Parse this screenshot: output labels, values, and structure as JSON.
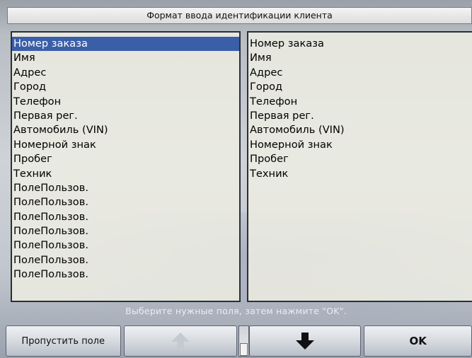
{
  "window": {
    "title": "Формат ввода идентификации клиента"
  },
  "left_list": {
    "items": [
      "Номер заказа",
      "Имя",
      "Адрес",
      "Город",
      "Телефон",
      "Первая рег.",
      "Автомобиль (VIN)",
      "Номерной знак",
      "Пробег",
      "Техник",
      "ПолеПользов.",
      "ПолеПользов.",
      "ПолеПользов.",
      "ПолеПользов.",
      "ПолеПользов.",
      "ПолеПользов.",
      "ПолеПользов."
    ],
    "selected_index": 0
  },
  "right_list": {
    "items": [
      "Номер заказа",
      "Имя",
      "Адрес",
      "Город",
      "Телефон",
      "Первая рег.",
      "Автомобиль (VIN)",
      "Номерной знак",
      "Пробег",
      "Техник"
    ]
  },
  "hint": "Выберите нужные поля, затем нажмите \"OK\".",
  "toolbar": {
    "skip_label": "Пропустить поле",
    "up_icon": "arrow-up-icon",
    "down_icon": "arrow-down-icon",
    "ok_label": "OK"
  },
  "colors": {
    "selection": "#3a5ea8",
    "panel_bg": "#ecece2",
    "up_arrow": "#c5cad2",
    "down_arrow": "#111111"
  }
}
